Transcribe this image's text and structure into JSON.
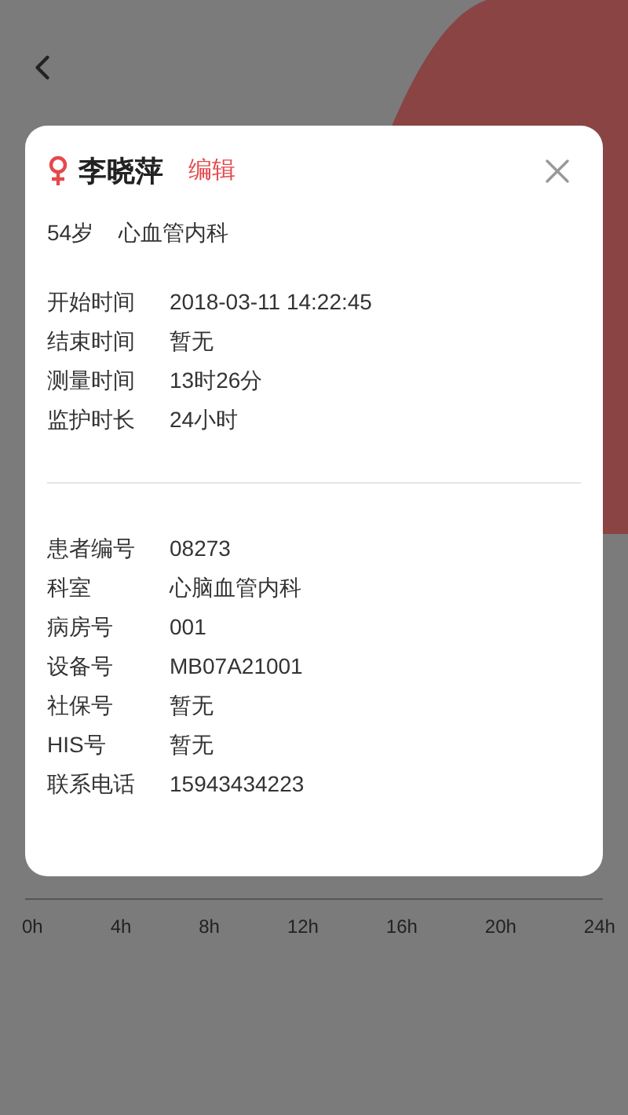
{
  "patient": {
    "name": "李晓萍",
    "edit_label": "编辑",
    "age": "54岁",
    "department": "心血管内科"
  },
  "time_info": [
    {
      "label": "开始时间",
      "value": "2018-03-11 14:22:45"
    },
    {
      "label": "结束时间",
      "value": "暂无"
    },
    {
      "label": "测量时间",
      "value": "13时26分"
    },
    {
      "label": "监护时长",
      "value": "24小时"
    }
  ],
  "details": [
    {
      "label": "患者编号",
      "value": "08273"
    },
    {
      "label": "科室",
      "value": "心脑血管内科"
    },
    {
      "label": "病房号",
      "value": "001"
    },
    {
      "label": "设备号",
      "value": "MB07A21001"
    },
    {
      "label": "社保号",
      "value": "暂无"
    },
    {
      "label": "HIS号",
      "value": "暂无"
    },
    {
      "label": "联系电话",
      "value": "15943434223"
    }
  ],
  "timeline": {
    "ticks": [
      "0h",
      "4h",
      "8h",
      "12h",
      "16h",
      "20h",
      "24h"
    ]
  }
}
